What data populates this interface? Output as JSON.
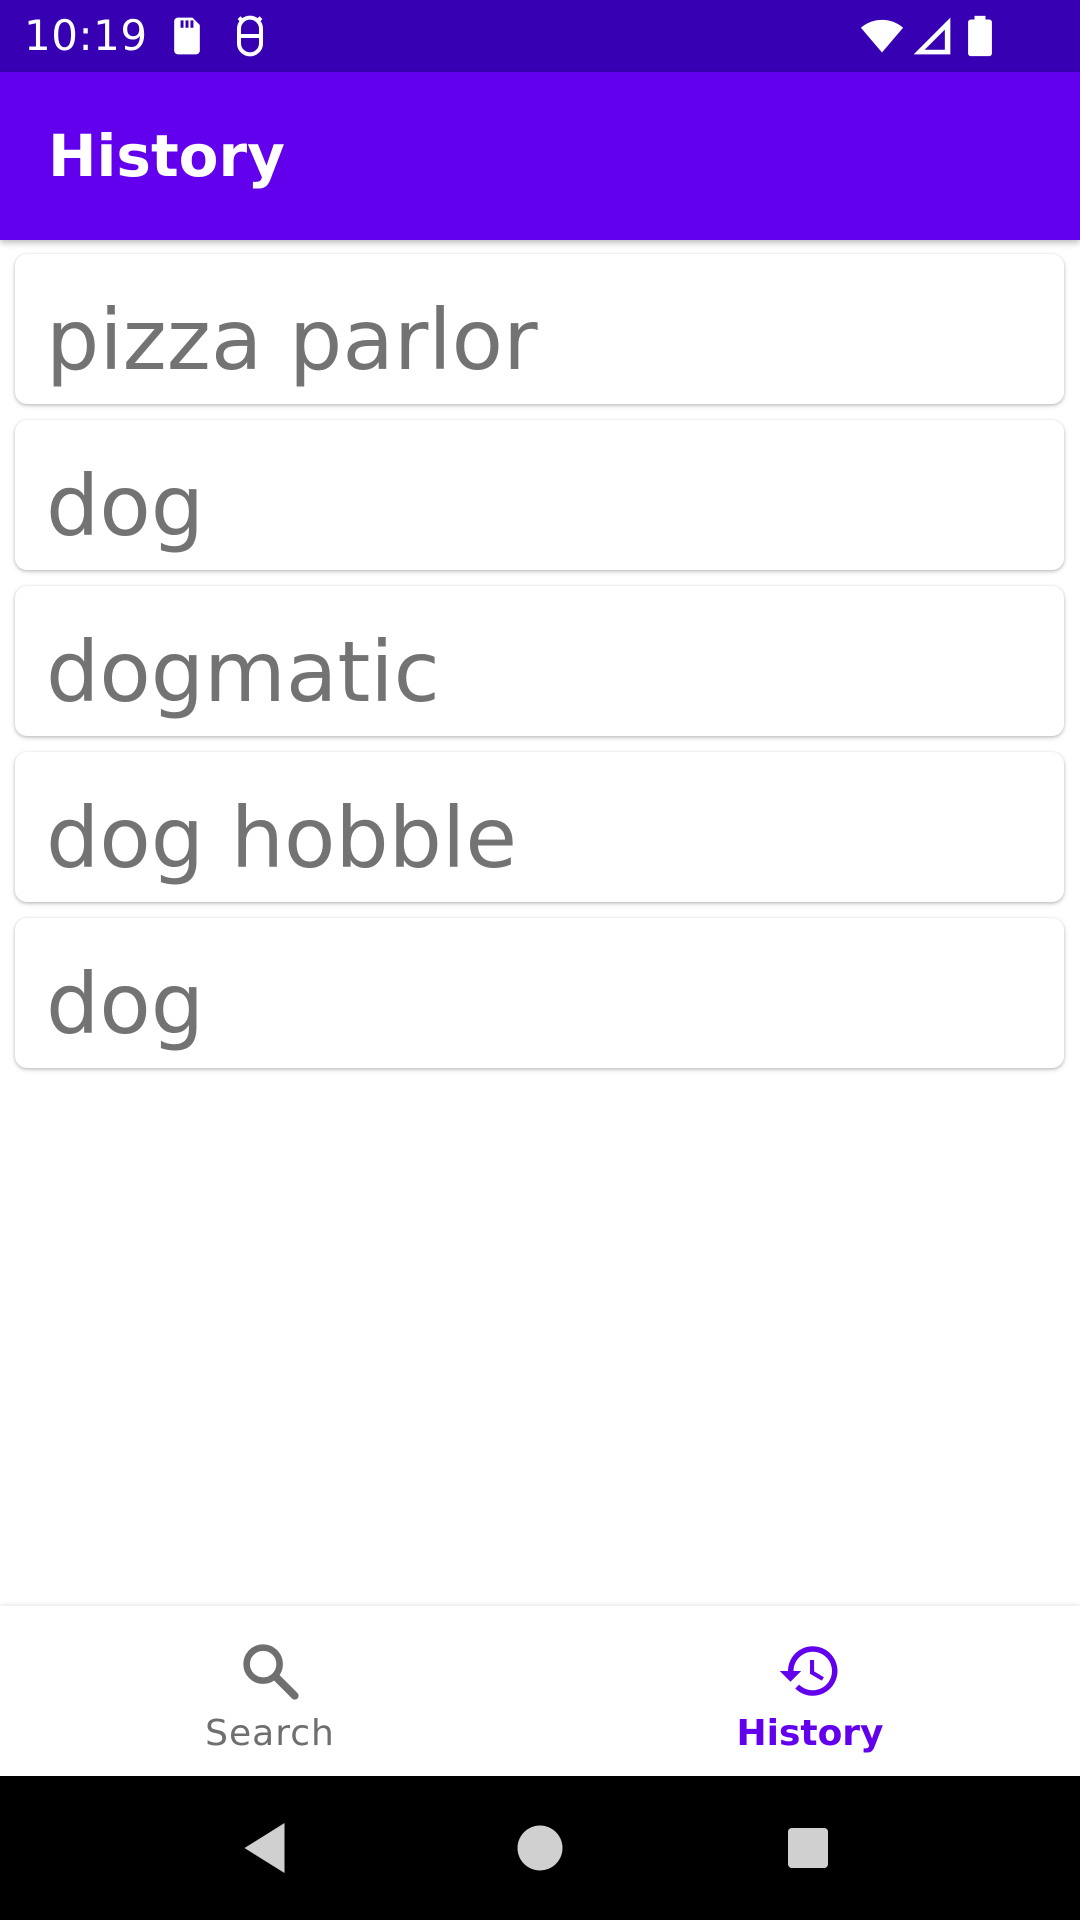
{
  "status_bar": {
    "time": "10:19",
    "icons": [
      "sd-card-icon",
      "debug-icon",
      "wifi-icon",
      "signal-icon",
      "battery-icon"
    ]
  },
  "app_bar": {
    "title": "History"
  },
  "history": {
    "items": [
      {
        "label": "pizza parlor"
      },
      {
        "label": "dog"
      },
      {
        "label": "dogmatic"
      },
      {
        "label": "dog hobble"
      },
      {
        "label": "dog"
      }
    ]
  },
  "bottom_nav": {
    "items": [
      {
        "label": "Search",
        "icon": "search-icon",
        "selected": false
      },
      {
        "label": "History",
        "icon": "history-icon",
        "selected": true
      }
    ]
  },
  "system_nav": {
    "buttons": [
      "back-icon",
      "home-icon",
      "recents-icon"
    ]
  },
  "colors": {
    "status_bar": "#3700b3",
    "primary": "#6200ee",
    "item_text": "#737373",
    "nav_inactive": "#6f6f6f"
  }
}
